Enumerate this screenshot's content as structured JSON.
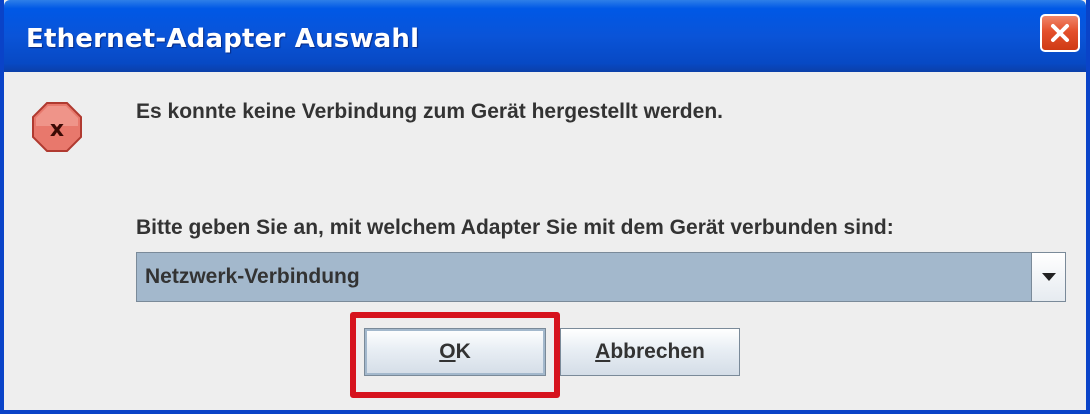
{
  "window": {
    "title": "Ethernet-Adapter Auswahl",
    "close_icon": "close-x-icon"
  },
  "dialog": {
    "icon": "error-icon",
    "message": "Es konnte keine Verbindung zum Gerät hergestellt werden.",
    "prompt": "Bitte geben Sie an, mit welchem Adapter Sie mit dem Gerät verbunden sind:",
    "adapter_select": {
      "selected": "Netzwerk-Verbindung",
      "arrow_icon": "chevron-down-icon"
    },
    "buttons": {
      "ok": {
        "mnemonic": "O",
        "rest": "K"
      },
      "cancel": {
        "mnemonic": "A",
        "rest": "bbrechen"
      }
    }
  },
  "colors": {
    "titlebar": "#0a54d8",
    "highlight": "#d6131e",
    "combo_bg": "#a3b8cc",
    "error_icon": "#e8786c"
  }
}
